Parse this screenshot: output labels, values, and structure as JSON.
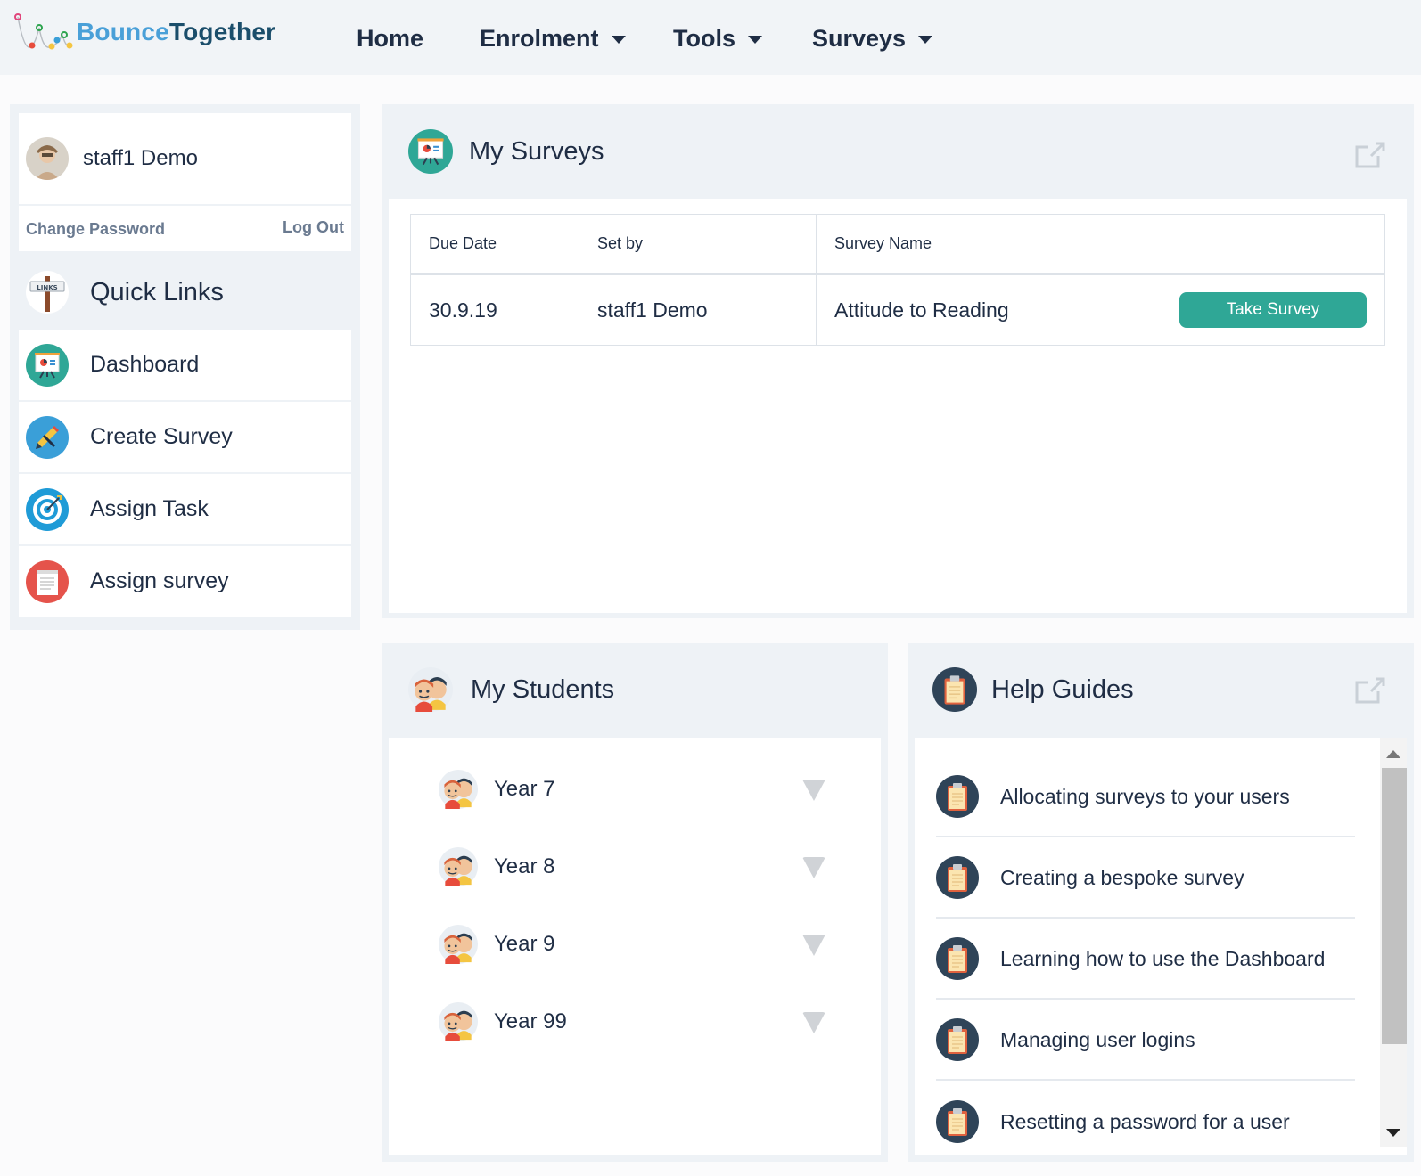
{
  "brand": {
    "part1": "Bounce",
    "part2": "Together"
  },
  "nav": {
    "home": "Home",
    "enrolment": "Enrolment",
    "tools": "Tools",
    "surveys": "Surveys"
  },
  "sidebar": {
    "user_name": "staff1 Demo",
    "change_password": "Change Password",
    "log_out": "Log Out",
    "quick_links_title": "Quick Links",
    "items": [
      {
        "label": "Dashboard",
        "icon": "dashboard-icon"
      },
      {
        "label": "Create Survey",
        "icon": "pencil-icon"
      },
      {
        "label": "Assign Task",
        "icon": "target-icon"
      },
      {
        "label": "Assign survey",
        "icon": "document-icon"
      }
    ]
  },
  "my_surveys": {
    "title": "My Surveys",
    "columns": [
      "Due Date",
      "Set by",
      "Survey Name"
    ],
    "rows": [
      {
        "due": "30.9.19",
        "set_by": "staff1 Demo",
        "name": "Attitude to Reading",
        "action": "Take Survey"
      }
    ]
  },
  "my_students": {
    "title": "My Students",
    "items": [
      "Year 7",
      "Year 8",
      "Year 9",
      "Year 99"
    ]
  },
  "help_guides": {
    "title": "Help Guides",
    "items": [
      "Allocating surveys to your users",
      "Creating a bespoke survey",
      "Learning how to use the Dashboard",
      "Managing user logins",
      "Resetting a password for a user"
    ]
  },
  "colors": {
    "accent": "#2fa796",
    "nav_bg": "#f1f4f7",
    "panel_bg": "#eef2f6",
    "text": "#1f2d44"
  }
}
